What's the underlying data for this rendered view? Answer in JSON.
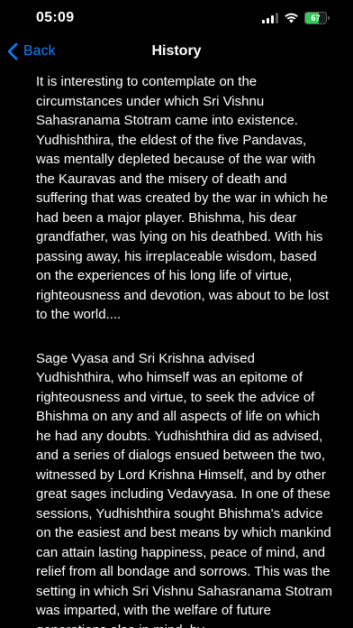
{
  "status_bar": {
    "time": "05:09",
    "battery_percent": "67",
    "battery_level": 0.67,
    "accent_color": "#34c759"
  },
  "nav": {
    "back_label": "Back",
    "title": "History",
    "back_icon": "chevron-left-icon",
    "tint_color": "#0a84ff"
  },
  "content": {
    "paragraphs": [
      "It is interesting to contemplate on the circumstances under which Sri Vishnu Sahasranama Stotram came into existence. Yudhishthira, the eldest of the five Pandavas, was mentally depleted because of the war with the Kauravas and the misery of death and suffering that was created by the war in which he had been a major player. Bhishma, his dear grandfather, was lying on his deathbed. With his passing away, his irreplaceable wisdom, based on the experiences of his long life of virtue, righteousness and devotion, was about to be lost to the world....",
      "Sage Vyasa and Sri Krishna advised Yudhishthira, who himself was an epitome of righteousness and virtue, to seek the advice of Bhishma on any and all aspects of life on which he had any doubts. Yudhishthira did as advised, and a series of dialogs ensued between the two, witnessed by Lord Krishna Himself, and by other great sages including Vedavyasa. In one of these sessions, Yudhishthira sought Bhishma's advice on the easiest and best means by which mankind can attain lasting happiness, peace of mind, and relief from all bondage and sorrows. This was the setting in which Sri Vishnu Sahasranama Stotram was imparted, with the welfare of future generations also in mind, by"
    ]
  }
}
